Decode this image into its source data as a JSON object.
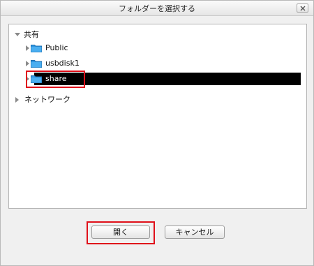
{
  "dialog": {
    "title": "フォルダーを選択する",
    "close_icon": "close-icon"
  },
  "tree": {
    "root_shared": "共有",
    "folders": [
      "Public",
      "usbdisk1",
      "share"
    ],
    "selected_folder": "share",
    "network": "ネットワーク"
  },
  "buttons": {
    "open": "開く",
    "cancel": "キャンセル"
  },
  "colors": {
    "selection": "#000000",
    "highlight": "#e0101a",
    "folder": "#2f95e0"
  }
}
